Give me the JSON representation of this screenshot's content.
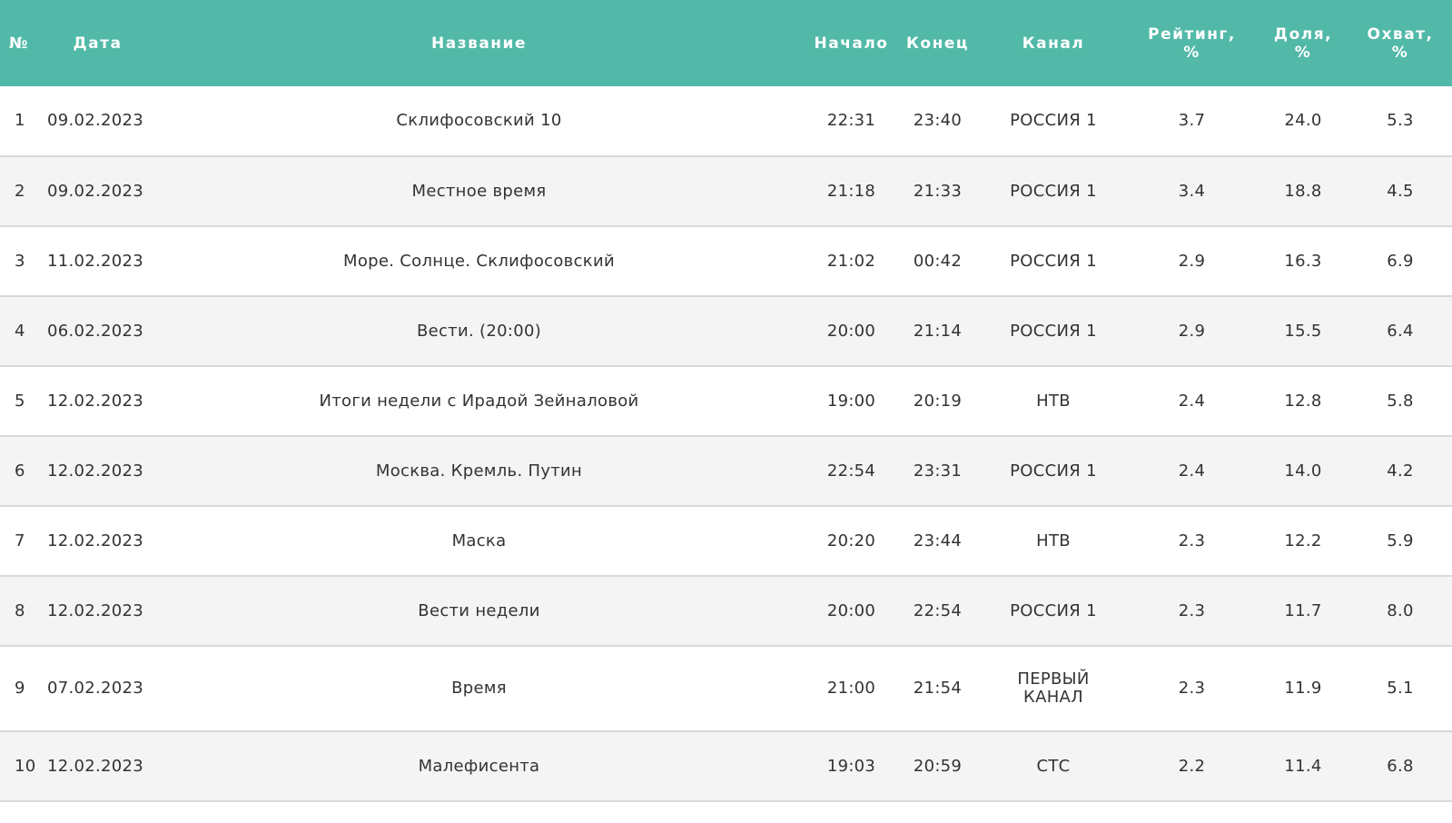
{
  "header": {
    "num": "№",
    "date": "Дата",
    "title": "Название",
    "start": "Начало",
    "end": "Конец",
    "channel": "Канал",
    "rating": "Рейтинг,\n%",
    "share": "Доля,\n%",
    "reach": "Охват,\n%"
  },
  "rows": [
    {
      "num": "1",
      "date": "09.02.2023",
      "title": "Склифосовский 10",
      "start": "22:31",
      "end": "23:40",
      "channel": "РОССИЯ 1",
      "rating": "3.7",
      "share": "24.0",
      "reach": "5.3"
    },
    {
      "num": "2",
      "date": "09.02.2023",
      "title": "Местное время",
      "start": "21:18",
      "end": "21:33",
      "channel": "РОССИЯ 1",
      "rating": "3.4",
      "share": "18.8",
      "reach": "4.5"
    },
    {
      "num": "3",
      "date": "11.02.2023",
      "title": "Море. Солнце. Склифосовский",
      "start": "21:02",
      "end": "00:42",
      "channel": "РОССИЯ 1",
      "rating": "2.9",
      "share": "16.3",
      "reach": "6.9"
    },
    {
      "num": "4",
      "date": "06.02.2023",
      "title": "Вести. (20:00)",
      "start": "20:00",
      "end": "21:14",
      "channel": "РОССИЯ 1",
      "rating": "2.9",
      "share": "15.5",
      "reach": "6.4"
    },
    {
      "num": "5",
      "date": "12.02.2023",
      "title": "Итоги недели с Ирадой Зейналовой",
      "start": "19:00",
      "end": "20:19",
      "channel": "НТВ",
      "rating": "2.4",
      "share": "12.8",
      "reach": "5.8"
    },
    {
      "num": "6",
      "date": "12.02.2023",
      "title": "Москва. Кремль. Путин",
      "start": "22:54",
      "end": "23:31",
      "channel": "РОССИЯ 1",
      "rating": "2.4",
      "share": "14.0",
      "reach": "4.2"
    },
    {
      "num": "7",
      "date": "12.02.2023",
      "title": "Маска",
      "start": "20:20",
      "end": "23:44",
      "channel": "НТВ",
      "rating": "2.3",
      "share": "12.2",
      "reach": "5.9"
    },
    {
      "num": "8",
      "date": "12.02.2023",
      "title": "Вести недели",
      "start": "20:00",
      "end": "22:54",
      "channel": "РОССИЯ 1",
      "rating": "2.3",
      "share": "11.7",
      "reach": "8.0"
    },
    {
      "num": "9",
      "date": "07.02.2023",
      "title": "Время",
      "start": "21:00",
      "end": "21:54",
      "channel": "ПЕРВЫЙ\nКАНАЛ",
      "rating": "2.3",
      "share": "11.9",
      "reach": "5.1"
    },
    {
      "num": "10",
      "date": "12.02.2023",
      "title": "Малефисента",
      "start": "19:03",
      "end": "20:59",
      "channel": "СТС",
      "rating": "2.2",
      "share": "11.4",
      "reach": "6.8"
    }
  ]
}
